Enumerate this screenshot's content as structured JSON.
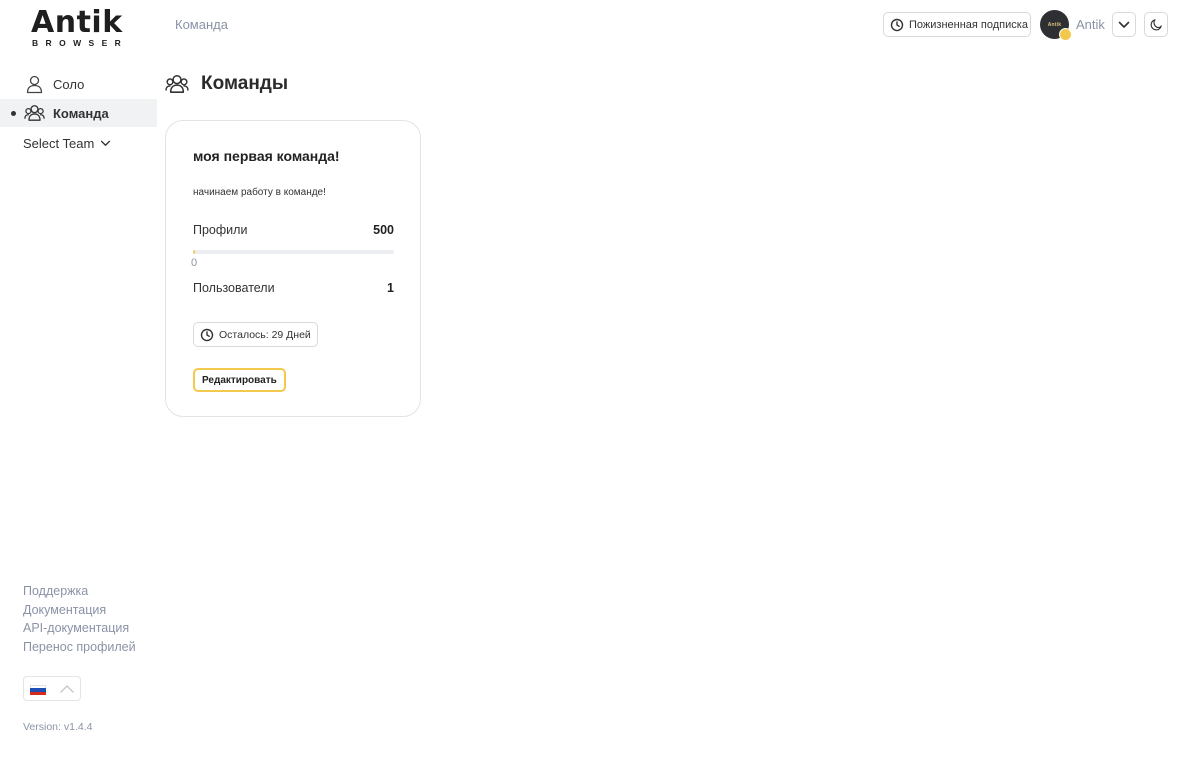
{
  "brand": {
    "logo_text": "Antik",
    "logo_sub": "BROWSER"
  },
  "header": {
    "breadcrumb": "Команда",
    "subscription_label": "Пожизненная подписка",
    "avatar_text": "Antik",
    "username": "Antik"
  },
  "sidebar": {
    "items": [
      {
        "label": "Соло",
        "icon": "user-icon",
        "active": false
      },
      {
        "label": "Команда",
        "icon": "users-icon",
        "active": true
      }
    ],
    "select_team": "Select Team",
    "footer_links": [
      "Поддержка",
      "Документация",
      "API-документация",
      "Перенос профилей"
    ],
    "language_flag": "flag-ru-icon",
    "version": "Version: v1.4.4"
  },
  "main": {
    "title": "Команды",
    "card": {
      "name": "моя первая команда!",
      "description": "начинаем работу в команде!",
      "profiles_label": "Профили",
      "profiles_max": "500",
      "profiles_used": "0",
      "profiles_used_fraction": 0.012,
      "users_label": "Пользователи",
      "users_count": "1",
      "remaining": "Осталось: 29 Дней",
      "edit_label": "Редактировать"
    }
  },
  "colors": {
    "accent": "#f2c94c",
    "muted": "#8a93a6",
    "active_bg": "#f1f2f4"
  }
}
